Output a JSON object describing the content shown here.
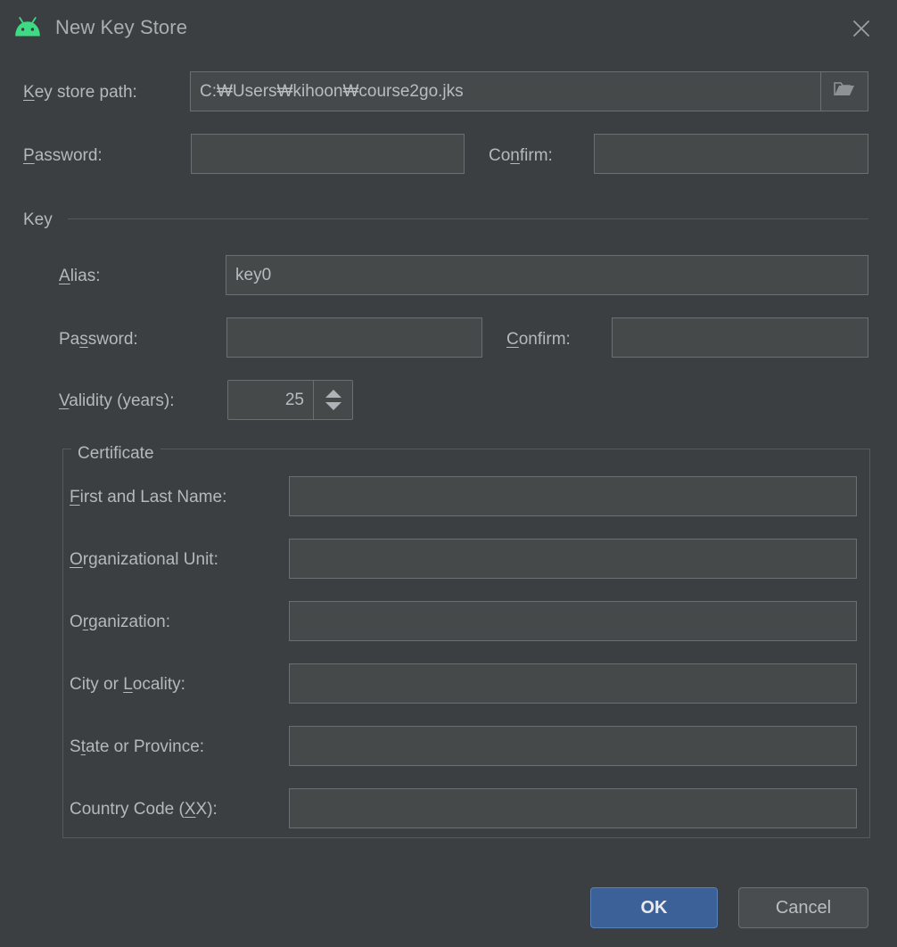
{
  "window": {
    "title": "New Key Store",
    "app_icon": "android-robot-icon",
    "close_icon": "close-icon",
    "accent_color": "#3c6199",
    "android_green": "#3ddc84",
    "background_color": "#3c3f41",
    "field_background": "#45494a",
    "field_border": "#6a6f71",
    "text_color": "#b4b9bd"
  },
  "keystore": {
    "path_label_pre": "",
    "path_label_mnemonic": "K",
    "path_label_post": "ey store path:",
    "path_value": "C:₩Users₩kihoon₩course2go.jks",
    "browse_icon": "folder-icon",
    "password_label_pre": "",
    "password_label_mnemonic": "P",
    "password_label_post": "assword:",
    "password_value": "",
    "confirm_label_pre": "Co",
    "confirm_label_mnemonic": "n",
    "confirm_label_post": "firm:",
    "confirm_value": ""
  },
  "key_section": {
    "title": "Key",
    "alias_label_pre": "",
    "alias_label_mnemonic": "A",
    "alias_label_post": "lias:",
    "alias_value": "key0",
    "password_label_pre": "Pa",
    "password_label_mnemonic": "s",
    "password_label_post": "sword:",
    "password_value": "",
    "confirm_label_pre": "",
    "confirm_label_mnemonic": "C",
    "confirm_label_post": "onfirm:",
    "confirm_value": "",
    "validity_label_pre": "",
    "validity_label_mnemonic": "V",
    "validity_label_post": "alidity (years):",
    "validity_value": "25",
    "spinner_up_icon": "chevron-up-icon",
    "spinner_down_icon": "chevron-down-icon"
  },
  "certificate": {
    "title": "Certificate",
    "fields": [
      {
        "name": "first-and-last-name",
        "label_pre": "",
        "label_mnemonic": "F",
        "label_post": "irst and Last Name:",
        "value": ""
      },
      {
        "name": "organizational-unit",
        "label_pre": "",
        "label_mnemonic": "O",
        "label_post": "rganizational Unit:",
        "value": ""
      },
      {
        "name": "organization",
        "label_pre": "O",
        "label_mnemonic": "r",
        "label_post": "ganization:",
        "value": ""
      },
      {
        "name": "city-or-locality",
        "label_pre": "City or ",
        "label_mnemonic": "L",
        "label_post": "ocality:",
        "value": ""
      },
      {
        "name": "state-or-province",
        "label_pre": "S",
        "label_mnemonic": "t",
        "label_post": "ate or Province:",
        "value": ""
      },
      {
        "name": "country-code",
        "label_pre": "Country Code (",
        "label_mnemonic": "X",
        "label_post": "X):",
        "value": ""
      }
    ]
  },
  "footer": {
    "ok_label": "OK",
    "cancel_label": "Cancel"
  }
}
